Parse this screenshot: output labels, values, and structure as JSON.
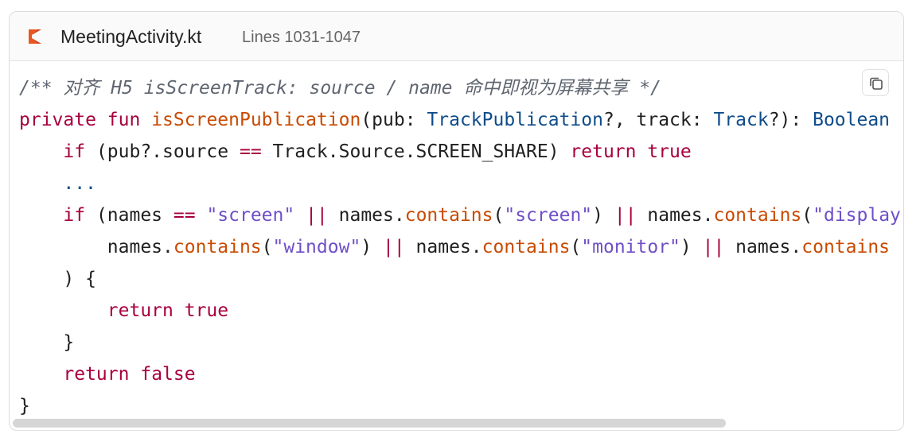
{
  "header": {
    "file_icon": "kotlin-icon",
    "file_name": "MeetingActivity.kt",
    "lines_label": "Lines 1031-1047"
  },
  "toolbar": {
    "copy_icon": "copy-icon"
  },
  "colors": {
    "keyword": "#a8003d",
    "function": "#c94a00",
    "type": "#0f4c8a",
    "string": "#6f4fc7",
    "comment": "#5f6670",
    "kotlin_orange": "#e8571f"
  },
  "code": {
    "line1": {
      "comment": "/** 对齐 H5 isScreenTrack: source / name 命中即视为屏幕共享 */"
    },
    "line2": {
      "kw_private": "private",
      "kw_fun": "fun",
      "fn_name": "isScreenPublication",
      "p1": "(pub: ",
      "t1": "TrackPublication",
      "p2": "?, track: ",
      "t2": "Track",
      "p3": "?): ",
      "t3": "Boolean"
    },
    "line3": {
      "kw_if": "if",
      "p1": " (pub?.source ",
      "op_eq": "==",
      "p2": " Track.Source.SCREEN_SHARE) ",
      "kw_return": "return",
      "kw_true": "true"
    },
    "line4": {
      "ellipsis": "..."
    },
    "line5": {
      "kw_if": "if",
      "p1": " (names ",
      "op_eq": "==",
      "s1": "\"screen\"",
      "op_or1": "||",
      "p2": " names.",
      "f1": "contains",
      "p3": "(",
      "s2": "\"screen\"",
      "p4": ") ",
      "op_or2": "||",
      "p5": " names.",
      "f2": "contains",
      "p6": "(",
      "s3": "\"display\""
    },
    "line6": {
      "p1": "names.",
      "f1": "contains",
      "p2": "(",
      "s1": "\"window\"",
      "p3": ") ",
      "op_or1": "||",
      "p4": " names.",
      "f2": "contains",
      "p5": "(",
      "s2": "\"monitor\"",
      "p6": ") ",
      "op_or2": "||",
      "p7": " names.",
      "f3": "contains"
    },
    "line7": {
      "text": ") {"
    },
    "line8": {
      "kw_return": "return",
      "kw_true": "true"
    },
    "line9": {
      "text": "}"
    },
    "line10": {
      "kw_return": "return",
      "kw_false": "false"
    },
    "line11": {
      "text": "}"
    }
  }
}
